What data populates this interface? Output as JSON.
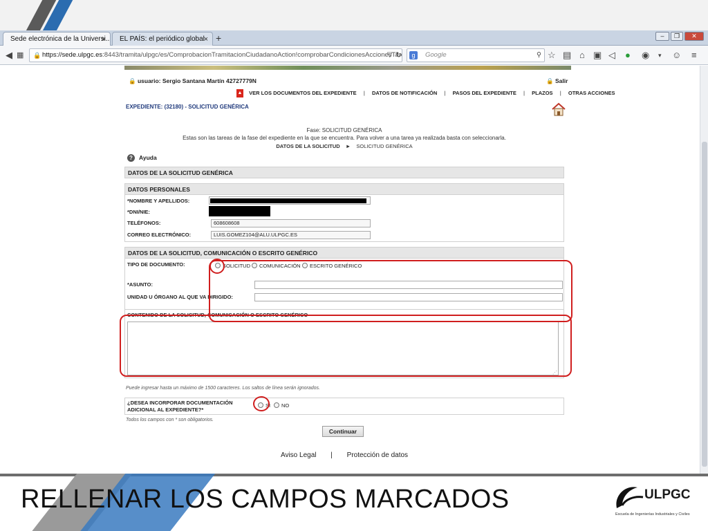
{
  "browser": {
    "tabs": [
      {
        "label": "Sede electrónica de la Universi...",
        "active": true
      },
      {
        "label": "EL PAÍS: el periódico global",
        "active": false
      }
    ],
    "new_tab": "+",
    "url_host": "https://sede.ulpgc.es",
    "url_rest": ":8443/tramita/ulpgc/es/ComprobacionTramitacionCiudadanoAction!comprobarCondicionesAccionesTareaDa",
    "search_placeholder": "Google"
  },
  "header": {
    "user": "usuario: Sergio Santana Martín 42727779N",
    "salir": "Salir",
    "menu": {
      "documents": "VER LOS DOCUMENTOS DEL EXPEDIENTE",
      "notifications": "DATOS DE NOTIFICACIÓN",
      "steps": "PASOS DEL EXPEDIENTE",
      "deadlines": "PLAZOS",
      "other": "OTRAS ACCIONES"
    },
    "expediente": "EXPEDIENTE: (32180) - SOLICITUD GENÉRICA"
  },
  "phase": {
    "line1": "Fase: SOLICITUD GENÉRICA",
    "line2": "Estas son las tareas de la fase del expediente en la que se encuentra. Para volver a una tarea ya realizada basta con seleccionarla.",
    "crumb_current": "DATOS DE LA SOLICITUD",
    "crumb_sep": "►",
    "crumb_next": "SOLICITUD GENÉRICA"
  },
  "help": "Ayuda",
  "form": {
    "main_title": "DATOS DE LA SOLICITUD GENÉRICA",
    "personal_title": "DATOS PERSONALES",
    "name_label": "*NOMBRE Y APELLIDOS:",
    "dni_label": "*DNI/NIE:",
    "phone_label": "TELÉFONOS:",
    "phone_value": "608608608",
    "email_label": "CORREO ELECTRÓNICO:",
    "email_value": "LUIS.GOMEZ104@ALU.ULPGC.ES",
    "request_title": "DATOS DE LA SOLICITUD, COMUNICACIÓN O ESCRITO GENÉRICO",
    "doc_type_label": "TIPO DE DOCUMENTO:",
    "doc_types": [
      "SOLICITUD",
      "COMUNICACIÓN",
      "ESCRITO GENÉRICO"
    ],
    "subject_label": "*ASUNTO:",
    "unit_label": "UNIDAD U ÓRGANO AL QUE VA DIRIGIDO:",
    "content_label": "CONTENIDO DE LA SOLICITUD, COMUNICACIÓN O ESCRITO GENÉRICO",
    "content_note": "Puede ingresar hasta un máximo de 1500 caracteres. Los saltos de línea serán ignorados.",
    "additional_label_1": "¿DESEA INCORPORAR DOCUMENTACIÓN",
    "additional_label_2": "ADICIONAL AL EXPEDIENTE?*",
    "yes": "SI",
    "no": "NO",
    "required_note": "Todos los campos con * son obligatorios.",
    "continue_button": "Continuar"
  },
  "footer": {
    "legal": "Aviso Legal",
    "sep": "|",
    "privacy": "Protección de datos"
  },
  "slide": {
    "caption": "RELLENAR LOS CAMPOS MARCADOS",
    "logo_name": "ULPGC",
    "logo_sub": "Escuela de Ingenierías Industriales y Civiles"
  },
  "colors": {
    "annotation_red": "#d01e1e",
    "link_blue": "#203a7c"
  }
}
